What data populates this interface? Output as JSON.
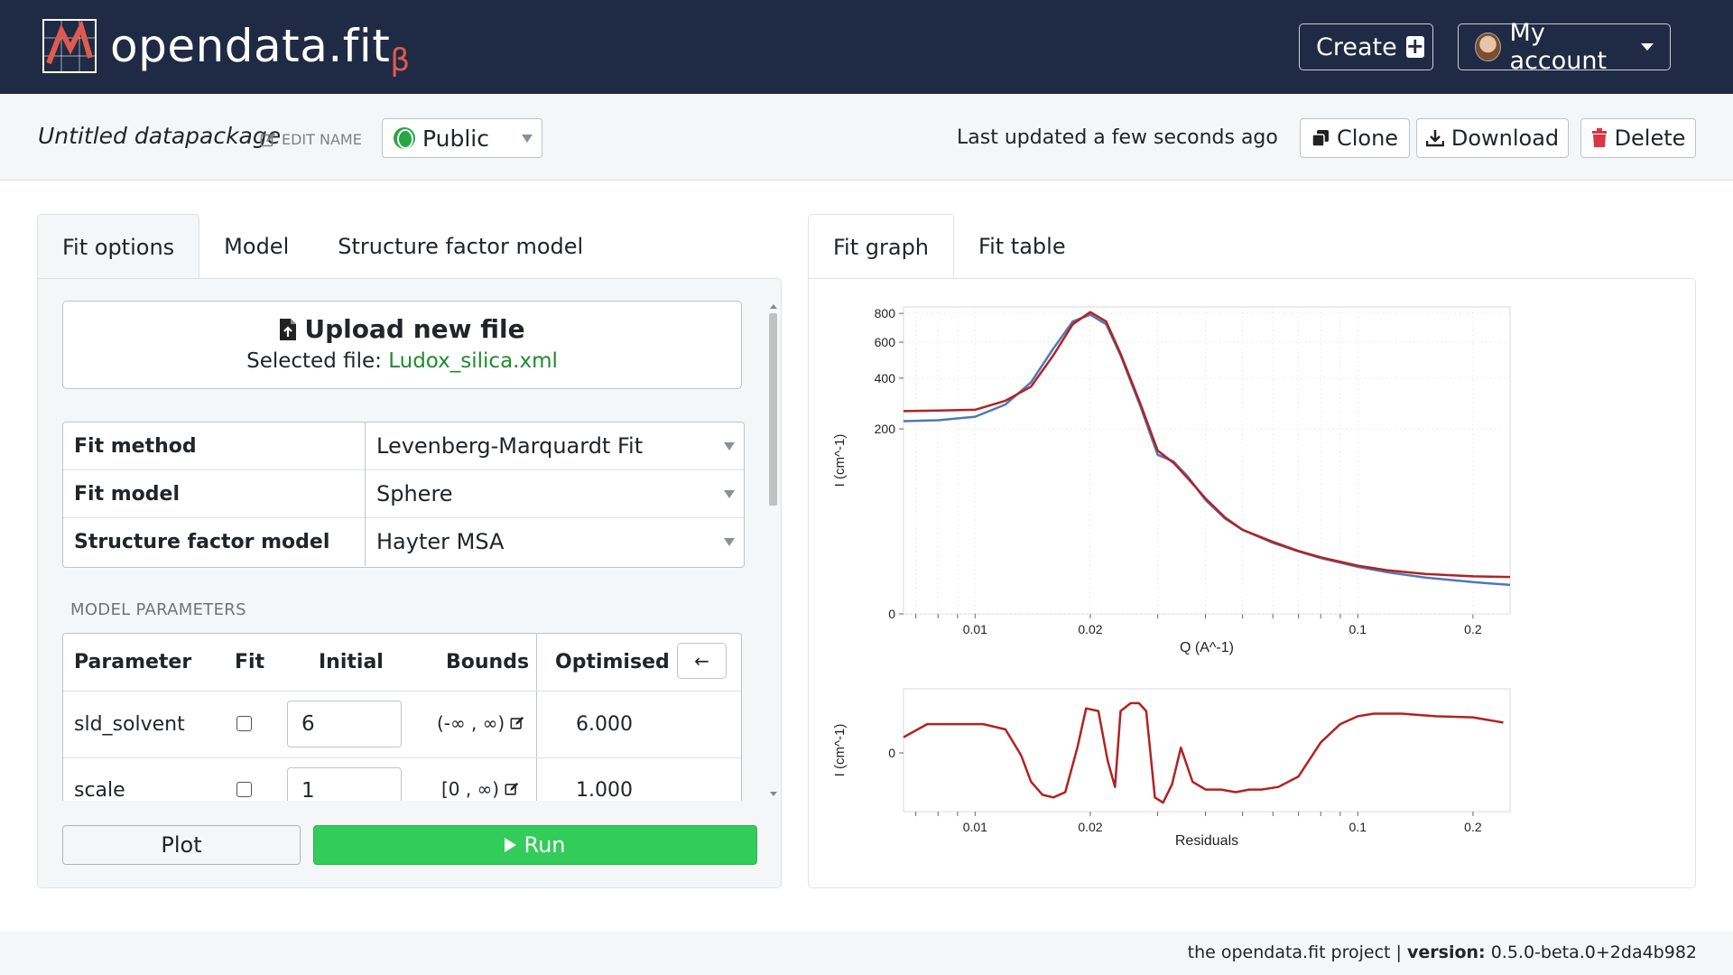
{
  "app": {
    "brand": "opendata.fit",
    "brand_suffix": "β",
    "create_label": "Create",
    "account_label": "My account"
  },
  "package": {
    "name": "Untitled datapackage",
    "edit_label": "EDIT NAME",
    "visibility": "Public",
    "last_updated": "Last updated a few seconds ago",
    "clone_label": "Clone",
    "download_label": "Download",
    "delete_label": "Delete"
  },
  "left_tabs": [
    "Fit options",
    "Model",
    "Structure factor model"
  ],
  "upload": {
    "title": "Upload new file",
    "selected_prefix": "Selected file:",
    "selected_file": "Ludox_silica.xml"
  },
  "options": [
    {
      "label": "Fit method",
      "value": "Levenberg-Marquardt Fit"
    },
    {
      "label": "Fit model",
      "value": "Sphere"
    },
    {
      "label": "Structure factor model",
      "value": "Hayter MSA"
    }
  ],
  "model_params": {
    "heading": "MODEL PARAMETERS",
    "columns": [
      "Parameter",
      "Fit",
      "Initial",
      "Bounds",
      "Optimised"
    ],
    "back_arrow": "←",
    "rows": [
      {
        "name": "sld_solvent",
        "initial": "6",
        "bounds": "(-∞ , ∞)",
        "optimised": "6.000"
      },
      {
        "name": "scale",
        "initial": "1",
        "bounds": "[0 , ∞)",
        "optimised": "1.000"
      }
    ]
  },
  "actions": {
    "plot_label": "Plot",
    "run_label": "Run"
  },
  "right_tabs": [
    "Fit graph",
    "Fit table"
  ],
  "chart_data": [
    {
      "type": "line",
      "xlabel": "Q (A^-1)",
      "ylabel": "I (cm^-1)",
      "x_scale": "log",
      "x_ticks": [
        "0.01",
        "0.02",
        "0.1",
        "0.2"
      ],
      "y_ticks": [
        "0",
        "200",
        "400",
        "600",
        "800"
      ],
      "grid": true,
      "series": [
        {
          "color": "#4e79b8",
          "x": [
            0.0065,
            0.008,
            0.01,
            0.012,
            0.014,
            0.016,
            0.018,
            0.02,
            0.022,
            0.024,
            0.027,
            0.03,
            0.033,
            0.036,
            0.04,
            0.045,
            0.05,
            0.06,
            0.07,
            0.08,
            0.1,
            0.12,
            0.15,
            0.2,
            0.25
          ],
          "y": [
            225,
            228,
            240,
            285,
            380,
            560,
            740,
            790,
            720,
            520,
            280,
            130,
            115,
            85,
            50,
            30,
            21,
            13,
            9,
            6.5,
            4,
            2.8,
            1.9,
            1.3,
            1.0
          ]
        },
        {
          "color": "#b22222",
          "x": [
            0.0065,
            0.008,
            0.01,
            0.012,
            0.014,
            0.016,
            0.018,
            0.02,
            0.022,
            0.024,
            0.027,
            0.03,
            0.033,
            0.036,
            0.04,
            0.045,
            0.05,
            0.06,
            0.07,
            0.08,
            0.1,
            0.12,
            0.15,
            0.2,
            0.25
          ],
          "y": [
            260,
            262,
            265,
            300,
            360,
            520,
            720,
            810,
            740,
            530,
            290,
            140,
            112,
            82,
            52,
            31,
            21,
            13.5,
            9.2,
            6.8,
            4.3,
            3.2,
            2.5,
            2.1,
            2.0
          ]
        }
      ]
    },
    {
      "type": "line",
      "xlabel": "Residuals",
      "ylabel": "I (cm^-1)",
      "x_scale": "log",
      "x_ticks": [
        "0.01",
        "0.02",
        "0.1",
        "0.2"
      ],
      "y_ticks": [
        "0"
      ],
      "series": [
        {
          "color": "#b22222",
          "x": [
            0.0065,
            0.0075,
            0.009,
            0.0105,
            0.012,
            0.0132,
            0.014,
            0.015,
            0.016,
            0.0172,
            0.0185,
            0.0195,
            0.021,
            0.0222,
            0.0232,
            0.024,
            0.0255,
            0.0268,
            0.028,
            0.0295,
            0.031,
            0.0327,
            0.0345,
            0.037,
            0.04,
            0.044,
            0.048,
            0.052,
            0.056,
            0.062,
            0.07,
            0.08,
            0.09,
            0.1,
            0.11,
            0.13,
            0.16,
            0.2,
            0.24
          ],
          "y": [
            0.3,
            0.55,
            0.55,
            0.55,
            0.45,
            -0.05,
            -0.55,
            -0.8,
            -0.85,
            -0.75,
            0.1,
            0.85,
            0.8,
            -0.15,
            -0.65,
            0.8,
            0.95,
            0.95,
            0.8,
            -0.85,
            -0.95,
            -0.6,
            0.1,
            -0.55,
            -0.7,
            -0.7,
            -0.75,
            -0.7,
            -0.7,
            -0.65,
            -0.45,
            0.2,
            0.55,
            0.7,
            0.75,
            0.75,
            0.7,
            0.68,
            0.58
          ]
        }
      ]
    }
  ],
  "footer": {
    "project": "the opendata.fit project |",
    "version_label": "version:",
    "version": "0.5.0-beta.0+2da4b982"
  }
}
